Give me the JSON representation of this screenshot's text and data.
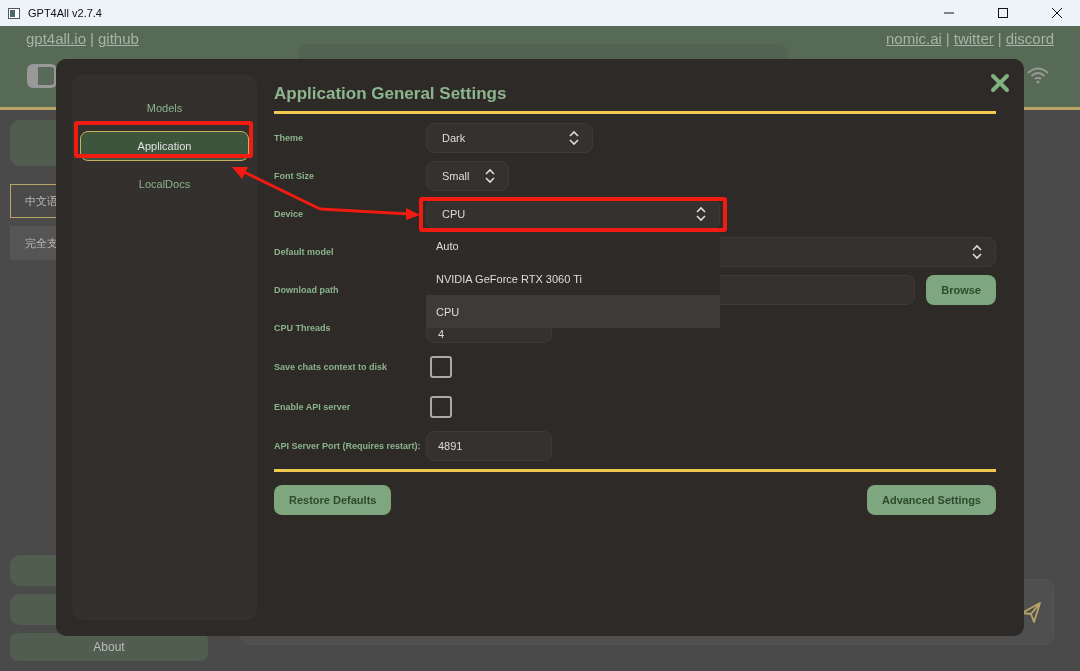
{
  "window": {
    "title": "GPT4All v2.7.4"
  },
  "header": {
    "toggle": {
      "on": false
    },
    "separator": "|",
    "left_links": [
      "gpt4all.io",
      "github"
    ],
    "right_links": [
      "nomic.ai",
      "twitter",
      "discord"
    ]
  },
  "background_sidebar": {
    "items": [
      {
        "label": "中文语",
        "selected": true
      },
      {
        "label": "完全支",
        "selected": false
      }
    ],
    "about": "About"
  },
  "settings": {
    "title": "Application General Settings",
    "nav": [
      {
        "label": "Models",
        "selected": false
      },
      {
        "label": "Application",
        "selected": true
      },
      {
        "label": "LocalDocs",
        "selected": false
      }
    ],
    "rows": [
      {
        "kind": "combo",
        "label": "Theme",
        "value": "Dark"
      },
      {
        "kind": "combo",
        "label": "Font Size",
        "value": "Small"
      },
      {
        "kind": "combo",
        "label": "Device",
        "value": "CPU",
        "expanded": true,
        "options": [
          {
            "label": "Auto",
            "selected": false
          },
          {
            "label": "NVIDIA GeForce RTX 3060 Ti",
            "selected": false
          },
          {
            "label": "CPU",
            "selected": true
          }
        ]
      },
      {
        "kind": "combo",
        "label": "Default model"
      },
      {
        "kind": "path",
        "label": "Download path",
        "button": "Browse"
      },
      {
        "kind": "text",
        "label": "CPU Threads",
        "value": "4"
      },
      {
        "kind": "checkbox",
        "label": "Save chats context to disk",
        "checked": false
      },
      {
        "kind": "checkbox",
        "label": "Enable API server",
        "checked": false
      },
      {
        "kind": "text",
        "label": "API Server Port (Requires restart):",
        "value": "4891"
      }
    ],
    "buttons": [
      "Restore Defaults",
      "Advanced Settings"
    ]
  }
}
